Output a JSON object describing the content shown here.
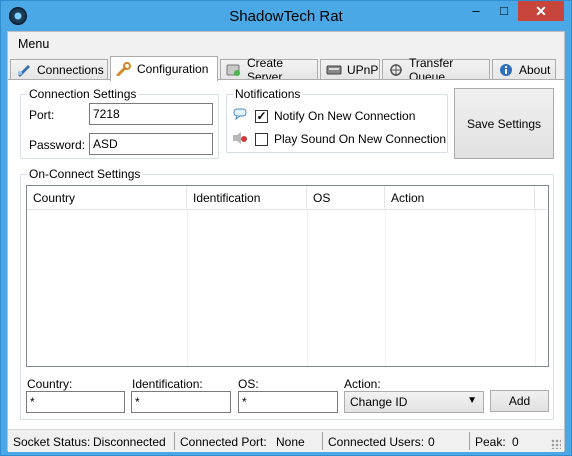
{
  "window": {
    "title": "ShadowTech Rat",
    "minimize": "–",
    "maximize": "□",
    "close": "✕"
  },
  "menu": {
    "label": "Menu"
  },
  "tabs": [
    {
      "label": "Connections",
      "icon": "satellite-icon"
    },
    {
      "label": "Configuration",
      "icon": "wrench-icon"
    },
    {
      "label": "Create Server",
      "icon": "server-icon"
    },
    {
      "label": "UPnP",
      "icon": "network-icon"
    },
    {
      "label": "Transfer Queue",
      "icon": "transfer-icon"
    },
    {
      "label": "About",
      "icon": "info-icon"
    }
  ],
  "connection_settings": {
    "title": "Connection Settings",
    "port_label": "Port:",
    "port_value": "7218",
    "password_label": "Password:",
    "password_value": "ASD"
  },
  "notifications": {
    "title": "Notifications",
    "notify_label": "Notify On New Connection",
    "notify_checked": true,
    "sound_label": "Play Sound On New Connection",
    "sound_checked": false
  },
  "save_button": "Save Settings",
  "on_connect": {
    "title": "On-Connect Settings",
    "columns": [
      "Country",
      "Identification",
      "OS",
      "Action"
    ],
    "rows": [],
    "country_label": "Country:",
    "country_value": "*",
    "identification_label": "Identification:",
    "identification_value": "*",
    "os_label": "OS:",
    "os_value": "*",
    "action_label": "Action:",
    "action_value": "Change ID",
    "add_button": "Add"
  },
  "status": {
    "socket_label": "Socket Status:",
    "socket_value": "Disconnected",
    "port_label": "Connected Port:",
    "port_value": "None",
    "users_label": "Connected Users:",
    "users_value": "0",
    "peak_label": "Peak:",
    "peak_value": "0"
  },
  "colors": {
    "titlebar": "#4aa8e6",
    "close": "#c7453a"
  }
}
